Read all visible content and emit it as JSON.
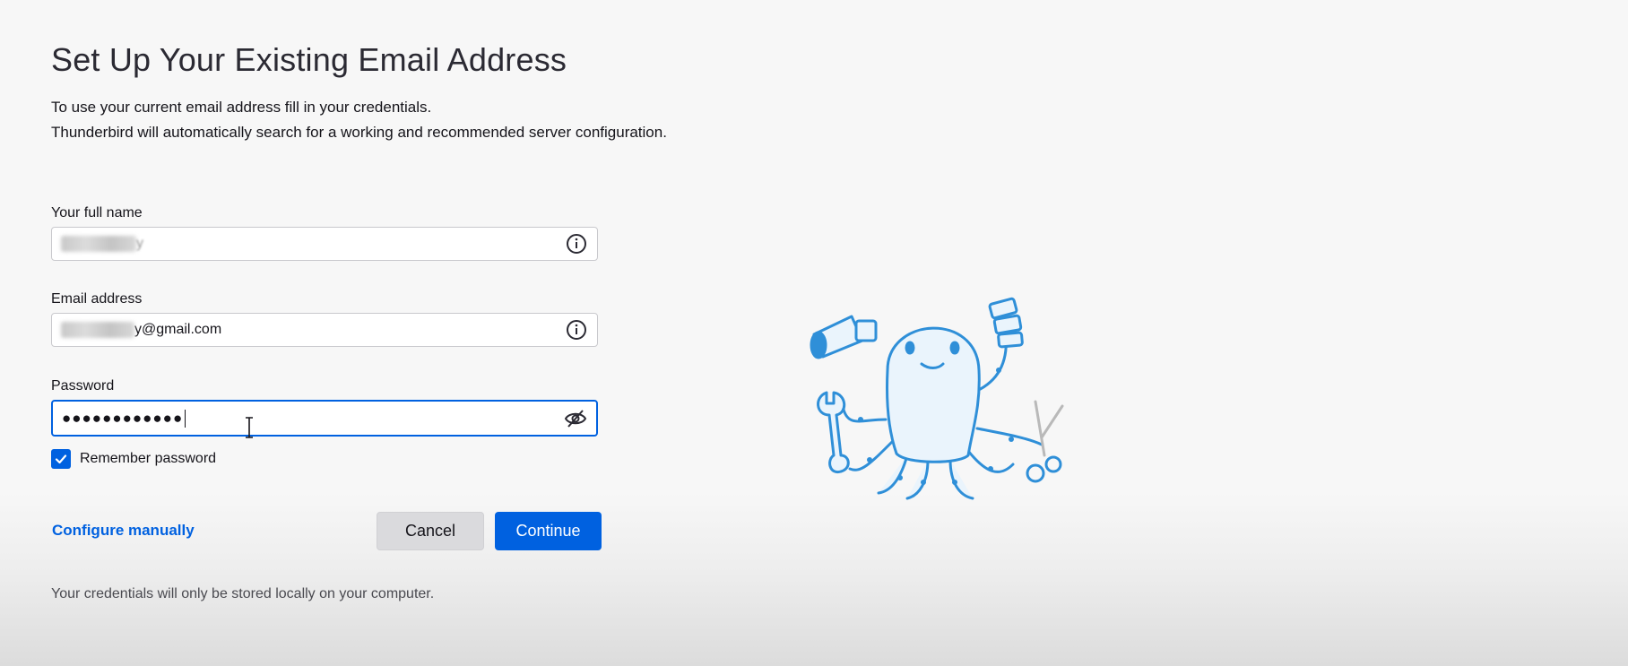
{
  "header": {
    "title": "Set Up Your Existing Email Address",
    "intro_line1": "To use your current email address fill in your credentials.",
    "intro_line2": "Thunderbird will automatically search for a working and recommended server configuration."
  },
  "form": {
    "full_name": {
      "label": "Your full name",
      "value_visible_suffix": "y",
      "value_redacted": true,
      "icon": "info-icon"
    },
    "email": {
      "label": "Email address",
      "value_visible_suffix": "y@gmail.com",
      "value_redacted": true,
      "icon": "info-icon"
    },
    "password": {
      "label": "Password",
      "masked_value": "●●●●●●●●●●●●",
      "icon": "eye-slash-icon",
      "focused": true
    },
    "remember_password": {
      "label": "Remember password",
      "checked": true
    }
  },
  "actions": {
    "configure_manually": "Configure manually",
    "cancel": "Cancel",
    "continue": "Continue"
  },
  "footer": {
    "note": "Your credentials will only be stored locally on your computer."
  },
  "illustration": {
    "name": "octopus-mascot-illustration"
  },
  "colors": {
    "accent": "#0061e0",
    "mascot_blue": "#2f8fd8",
    "mascot_fill": "#eaf4fc"
  }
}
